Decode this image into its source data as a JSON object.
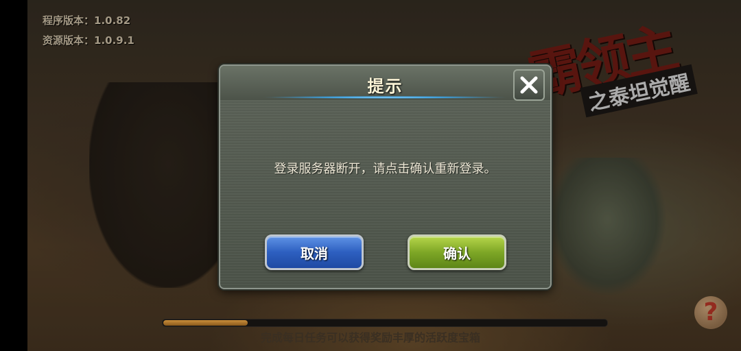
{
  "version": {
    "program": "程序版本：1.0.82",
    "resource": "资源版本：1.0.9.1"
  },
  "game_logo": {
    "title": "霸领主",
    "subtitle": "之泰坦觉醒"
  },
  "dialog": {
    "title": "提示",
    "message": "登录服务器断开，请点击确认重新登录。",
    "cancel_label": "取消",
    "confirm_label": "确认",
    "close_icon": "close-icon"
  },
  "loading": {
    "progress": 0.19,
    "tip": "完成每日任务可以获得奖励丰厚的活跃度宝箱"
  },
  "help": {
    "glyph": "?",
    "icon": "help-icon"
  },
  "colors": {
    "cancel_button": "#2d5fc0",
    "confirm_button": "#7ea726",
    "title_text": "#fbf3d6",
    "header_glow": "#3ca4e6"
  }
}
